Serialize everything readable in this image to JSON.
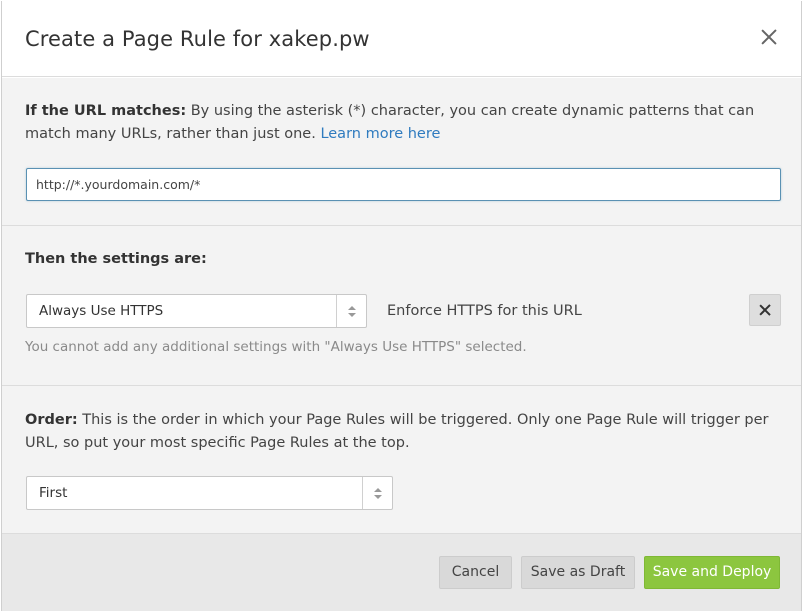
{
  "header": {
    "title": "Create a Page Rule for xakep.pw"
  },
  "url_section": {
    "label": "If the URL matches:",
    "description": " By using the asterisk (*) character, you can create dynamic patterns that can match many URLs, rather than just one. ",
    "link_text": "Learn more here",
    "input_value": "http://*.yourdomain.com/*"
  },
  "settings_section": {
    "heading": "Then the settings are:",
    "selected_setting": "Always Use HTTPS",
    "setting_description": "Enforce HTTPS for this URL",
    "note": "You cannot add any additional settings with \"Always Use HTTPS\" selected."
  },
  "order_section": {
    "label": "Order:",
    "description": " This is the order in which your Page Rules will be triggered. Only one Page Rule will trigger per URL, so put your most specific Page Rules at the top.",
    "selected_order": "First"
  },
  "footer": {
    "cancel_label": "Cancel",
    "draft_label": "Save as Draft",
    "deploy_label": "Save and Deploy"
  },
  "colors": {
    "accent_green": "#8cc63f",
    "link_blue": "#2f7bbf",
    "section_bg": "#f3f3f3"
  },
  "icons": [
    "close-icon",
    "remove-setting-icon",
    "select-arrows-icon"
  ]
}
